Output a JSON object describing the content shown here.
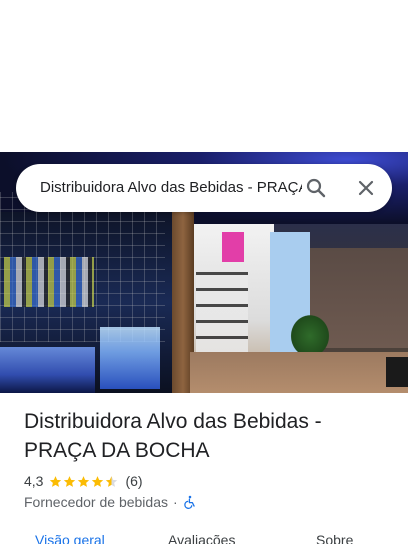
{
  "search": {
    "query": "Distribuidora Alvo das Bebidas - PRAÇA DA BOCHA",
    "search_icon": "search-icon",
    "close_icon": "close-icon"
  },
  "photo": {
    "description_icon": "place-photo"
  },
  "place": {
    "name": "Distribuidora Alvo das Bebidas - PRAÇA DA BOCHA",
    "rating": "4,3",
    "stars": 4.3,
    "review_count": "(6)",
    "category": "Fornecedor de bebidas",
    "separator": "·",
    "accessibility_icon": "wheelchair-icon"
  },
  "tabs": [
    {
      "label": "Visão geral",
      "active": true
    },
    {
      "label": "Avaliações",
      "active": false
    },
    {
      "label": "Sobre",
      "active": false
    }
  ],
  "colors": {
    "accent": "#1a73e8",
    "star": "#fbbc04",
    "text": "#202124",
    "secondary": "#5f6368"
  }
}
